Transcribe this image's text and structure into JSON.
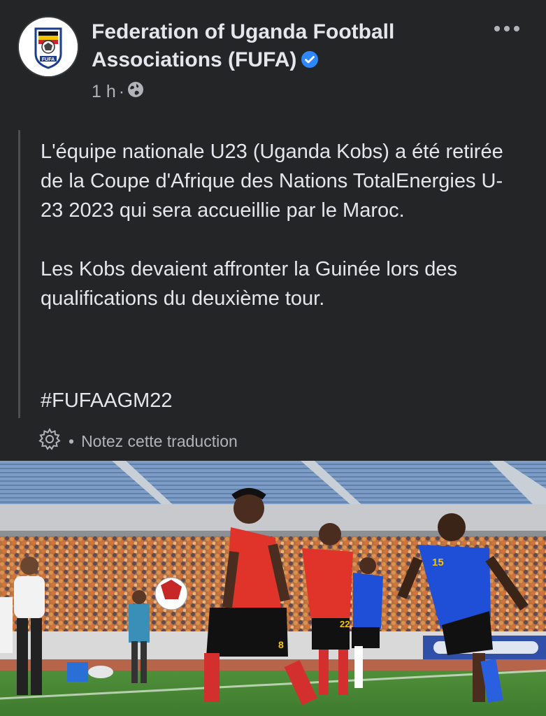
{
  "post": {
    "page_name": "Federation of Uganda Football Associations (FUFA)",
    "verified_icon": "verified-badge-icon",
    "time": "1 h",
    "separator": "·",
    "audience_icon": "globe-icon",
    "more_icon": "more-options-icon",
    "avatar_label": "FUFA",
    "paragraph_1": "L'équipe nationale U23 (Uganda Kobs) a été retirée de la Coupe d'Afrique des Nations TotalEnergies U-23 2023 qui sera accueillie par le Maroc.",
    "paragraph_2": "Les Kobs devaient affronter la Guinée lors des qualifications du deuxième tour.",
    "hashtag": "#FUFAAGM22",
    "translation": {
      "icon": "gear-icon",
      "bullet": "•",
      "rate_label": "Notez cette traduction"
    },
    "photo": {
      "jersey_left": "8",
      "jersey_mid": "22",
      "jersey_right": "15"
    }
  },
  "colors": {
    "background": "#242526",
    "text_primary": "#e4e6eb",
    "text_secondary": "#b0b3b8",
    "verified_blue": "#2d88ff",
    "uganda_red": "#e0342b",
    "tanzania_blue": "#1e4fd6"
  }
}
